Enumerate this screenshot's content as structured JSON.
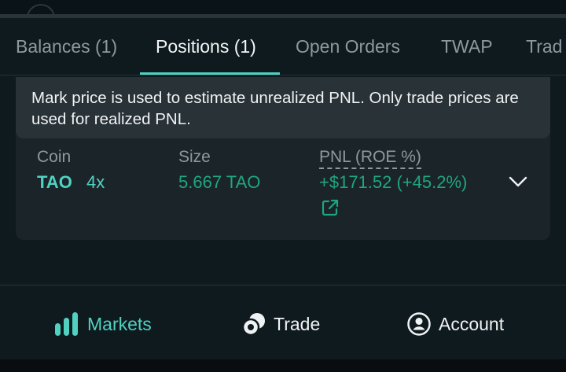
{
  "tabs": [
    {
      "label": "Balances (1)"
    },
    {
      "label": "Positions (1)"
    },
    {
      "label": "Open Orders"
    },
    {
      "label": "TWAP"
    },
    {
      "label": "Trad"
    }
  ],
  "active_tab": "Positions (1)",
  "notice": "Mark price is used to estimate unrealized PNL. Only trade prices are used for realized PNL.",
  "table": {
    "headers": {
      "coin": "Coin",
      "size": "Size",
      "pnl": "PNL (ROE %)"
    },
    "rows": [
      {
        "coin": "TAO",
        "leverage": "4x",
        "size": "5.667 TAO",
        "pnl": "+$171.52 (+45.2%)"
      }
    ]
  },
  "nav": {
    "markets": "Markets",
    "trade": "Trade",
    "account": "Account"
  },
  "colors": {
    "accent": "#50d2c1",
    "positive": "#1fa67d",
    "background": "#0f1a1f",
    "card": "#1b2429",
    "tooltip": "#283237",
    "muted": "#8d999e"
  },
  "icons": {
    "markets": "bar-chart-icon",
    "trade": "coins-icon",
    "account": "user-circle-icon",
    "expand": "chevron-down-icon",
    "share": "external-link-icon"
  }
}
